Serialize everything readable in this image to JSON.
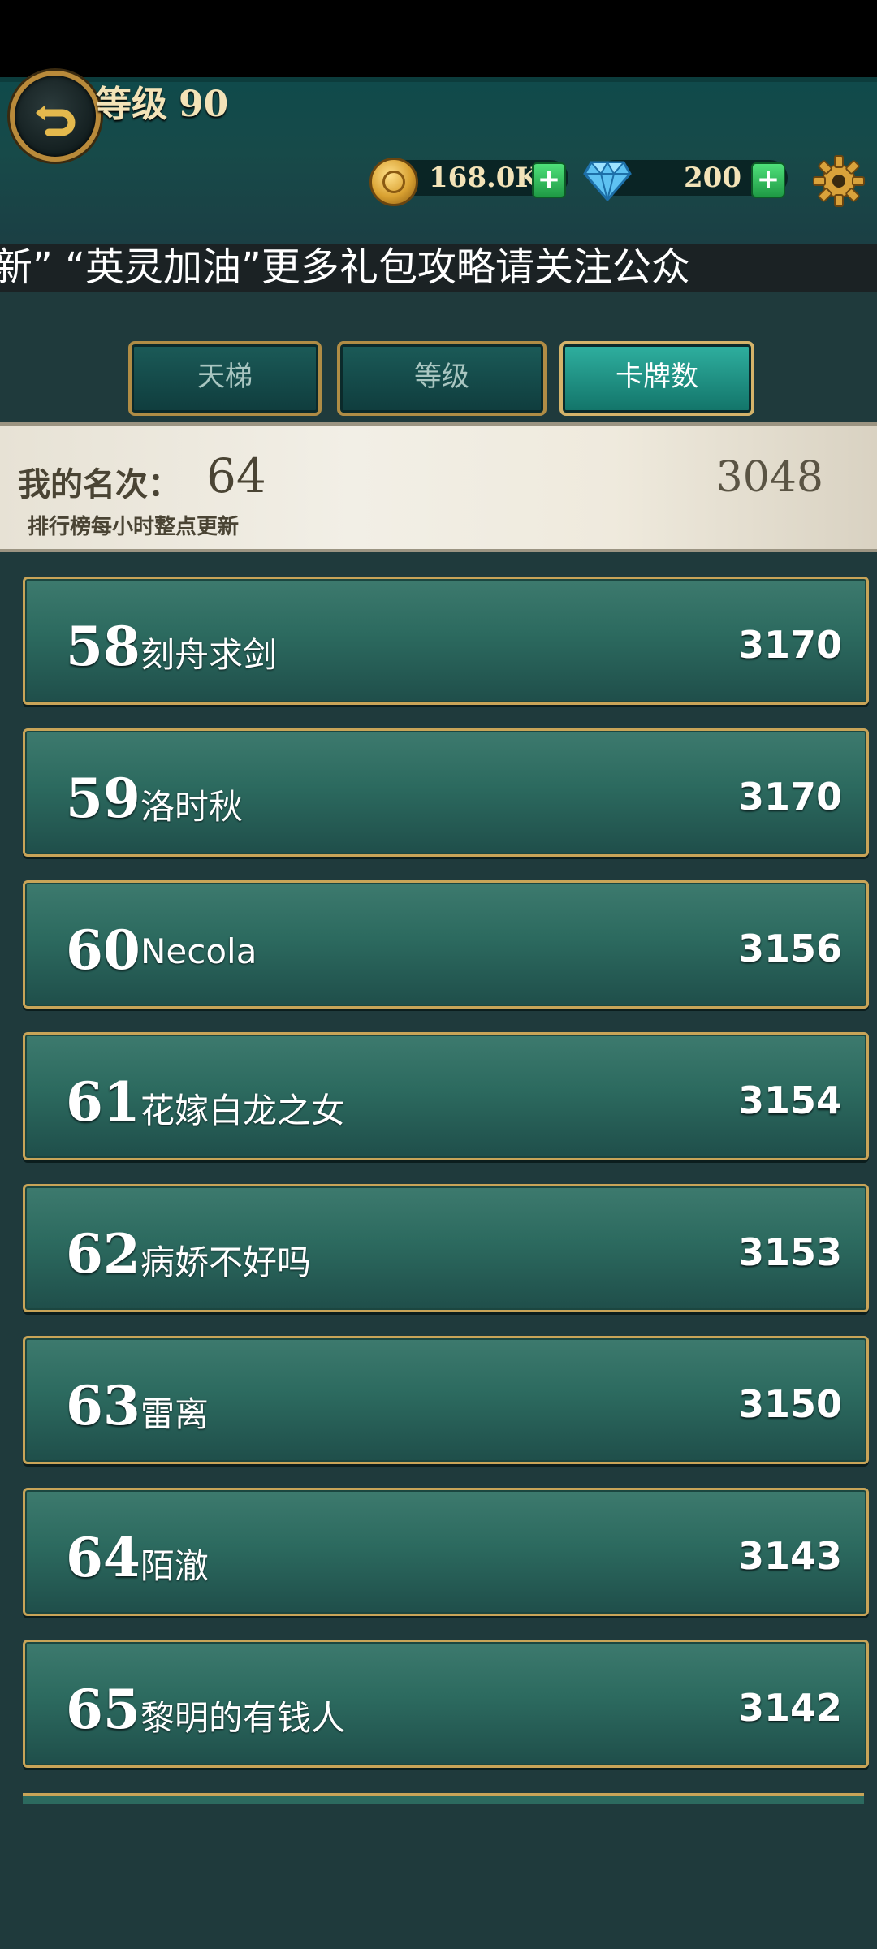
{
  "header": {
    "level_label": "等级",
    "level_value": "90",
    "gold_value": "168.0K",
    "gem_value": "200",
    "icons": [
      "back-icon",
      "coin-icon",
      "gem-icon",
      "gear-icon",
      "plus-icon"
    ]
  },
  "ticker": {
    "text": "新”    “英灵加油”更多礼包攻略请关注公众"
  },
  "tabs": [
    "天梯",
    "等级",
    "卡牌数"
  ],
  "active_tab": "卡牌数",
  "my_rank": {
    "label": "我的名次：",
    "value": "64",
    "score": "3048",
    "note": "排行榜每小时整点更新"
  },
  "rows": [
    {
      "rank": "58",
      "name": "刻舟求剑",
      "score": "3170"
    },
    {
      "rank": "59",
      "name": "洛时秋",
      "score": "3170"
    },
    {
      "rank": "60",
      "name": "Necola",
      "score": "3156"
    },
    {
      "rank": "61",
      "name": "花嫁白龙之女",
      "score": "3154"
    },
    {
      "rank": "62",
      "name": "病娇不好吗",
      "score": "3153"
    },
    {
      "rank": "63",
      "name": "雷离",
      "score": "3150"
    },
    {
      "rank": "64",
      "name": "陌澈",
      "score": "3143"
    },
    {
      "rank": "65",
      "name": "黎明的有钱人",
      "score": "3142"
    }
  ],
  "colors": {
    "background": "#1f3a3c",
    "row_green": "#2c6a5f",
    "gold_border": "#c8a458",
    "active_tab": "#2fb0a0"
  }
}
